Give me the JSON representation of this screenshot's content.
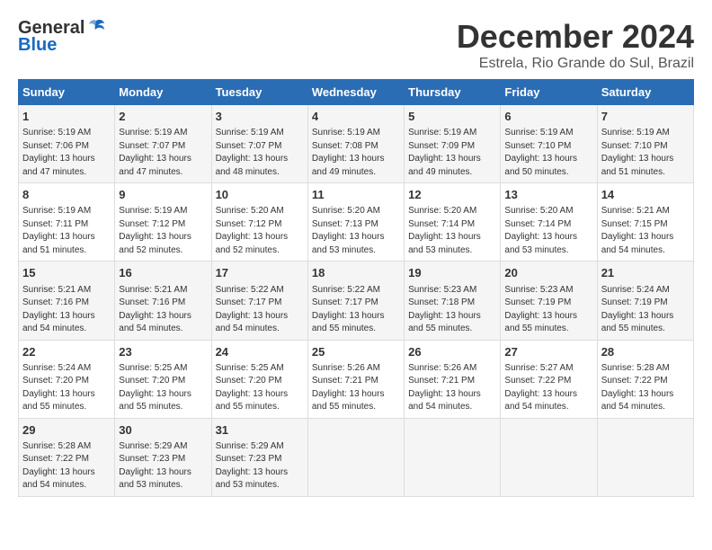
{
  "logo": {
    "general": "General",
    "blue": "Blue"
  },
  "title": "December 2024",
  "location": "Estrela, Rio Grande do Sul, Brazil",
  "days_header": [
    "Sunday",
    "Monday",
    "Tuesday",
    "Wednesday",
    "Thursday",
    "Friday",
    "Saturday"
  ],
  "weeks": [
    [
      {
        "day": "1",
        "text": "Sunrise: 5:19 AM\nSunset: 7:06 PM\nDaylight: 13 hours\nand 47 minutes."
      },
      {
        "day": "2",
        "text": "Sunrise: 5:19 AM\nSunset: 7:07 PM\nDaylight: 13 hours\nand 47 minutes."
      },
      {
        "day": "3",
        "text": "Sunrise: 5:19 AM\nSunset: 7:07 PM\nDaylight: 13 hours\nand 48 minutes."
      },
      {
        "day": "4",
        "text": "Sunrise: 5:19 AM\nSunset: 7:08 PM\nDaylight: 13 hours\nand 49 minutes."
      },
      {
        "day": "5",
        "text": "Sunrise: 5:19 AM\nSunset: 7:09 PM\nDaylight: 13 hours\nand 49 minutes."
      },
      {
        "day": "6",
        "text": "Sunrise: 5:19 AM\nSunset: 7:10 PM\nDaylight: 13 hours\nand 50 minutes."
      },
      {
        "day": "7",
        "text": "Sunrise: 5:19 AM\nSunset: 7:10 PM\nDaylight: 13 hours\nand 51 minutes."
      }
    ],
    [
      {
        "day": "8",
        "text": "Sunrise: 5:19 AM\nSunset: 7:11 PM\nDaylight: 13 hours\nand 51 minutes."
      },
      {
        "day": "9",
        "text": "Sunrise: 5:19 AM\nSunset: 7:12 PM\nDaylight: 13 hours\nand 52 minutes."
      },
      {
        "day": "10",
        "text": "Sunrise: 5:20 AM\nSunset: 7:12 PM\nDaylight: 13 hours\nand 52 minutes."
      },
      {
        "day": "11",
        "text": "Sunrise: 5:20 AM\nSunset: 7:13 PM\nDaylight: 13 hours\nand 53 minutes."
      },
      {
        "day": "12",
        "text": "Sunrise: 5:20 AM\nSunset: 7:14 PM\nDaylight: 13 hours\nand 53 minutes."
      },
      {
        "day": "13",
        "text": "Sunrise: 5:20 AM\nSunset: 7:14 PM\nDaylight: 13 hours\nand 53 minutes."
      },
      {
        "day": "14",
        "text": "Sunrise: 5:21 AM\nSunset: 7:15 PM\nDaylight: 13 hours\nand 54 minutes."
      }
    ],
    [
      {
        "day": "15",
        "text": "Sunrise: 5:21 AM\nSunset: 7:16 PM\nDaylight: 13 hours\nand 54 minutes."
      },
      {
        "day": "16",
        "text": "Sunrise: 5:21 AM\nSunset: 7:16 PM\nDaylight: 13 hours\nand 54 minutes."
      },
      {
        "day": "17",
        "text": "Sunrise: 5:22 AM\nSunset: 7:17 PM\nDaylight: 13 hours\nand 54 minutes."
      },
      {
        "day": "18",
        "text": "Sunrise: 5:22 AM\nSunset: 7:17 PM\nDaylight: 13 hours\nand 55 minutes."
      },
      {
        "day": "19",
        "text": "Sunrise: 5:23 AM\nSunset: 7:18 PM\nDaylight: 13 hours\nand 55 minutes."
      },
      {
        "day": "20",
        "text": "Sunrise: 5:23 AM\nSunset: 7:19 PM\nDaylight: 13 hours\nand 55 minutes."
      },
      {
        "day": "21",
        "text": "Sunrise: 5:24 AM\nSunset: 7:19 PM\nDaylight: 13 hours\nand 55 minutes."
      }
    ],
    [
      {
        "day": "22",
        "text": "Sunrise: 5:24 AM\nSunset: 7:20 PM\nDaylight: 13 hours\nand 55 minutes."
      },
      {
        "day": "23",
        "text": "Sunrise: 5:25 AM\nSunset: 7:20 PM\nDaylight: 13 hours\nand 55 minutes."
      },
      {
        "day": "24",
        "text": "Sunrise: 5:25 AM\nSunset: 7:20 PM\nDaylight: 13 hours\nand 55 minutes."
      },
      {
        "day": "25",
        "text": "Sunrise: 5:26 AM\nSunset: 7:21 PM\nDaylight: 13 hours\nand 55 minutes."
      },
      {
        "day": "26",
        "text": "Sunrise: 5:26 AM\nSunset: 7:21 PM\nDaylight: 13 hours\nand 54 minutes."
      },
      {
        "day": "27",
        "text": "Sunrise: 5:27 AM\nSunset: 7:22 PM\nDaylight: 13 hours\nand 54 minutes."
      },
      {
        "day": "28",
        "text": "Sunrise: 5:28 AM\nSunset: 7:22 PM\nDaylight: 13 hours\nand 54 minutes."
      }
    ],
    [
      {
        "day": "29",
        "text": "Sunrise: 5:28 AM\nSunset: 7:22 PM\nDaylight: 13 hours\nand 54 minutes."
      },
      {
        "day": "30",
        "text": "Sunrise: 5:29 AM\nSunset: 7:23 PM\nDaylight: 13 hours\nand 53 minutes."
      },
      {
        "day": "31",
        "text": "Sunrise: 5:29 AM\nSunset: 7:23 PM\nDaylight: 13 hours\nand 53 minutes."
      },
      null,
      null,
      null,
      null
    ]
  ]
}
